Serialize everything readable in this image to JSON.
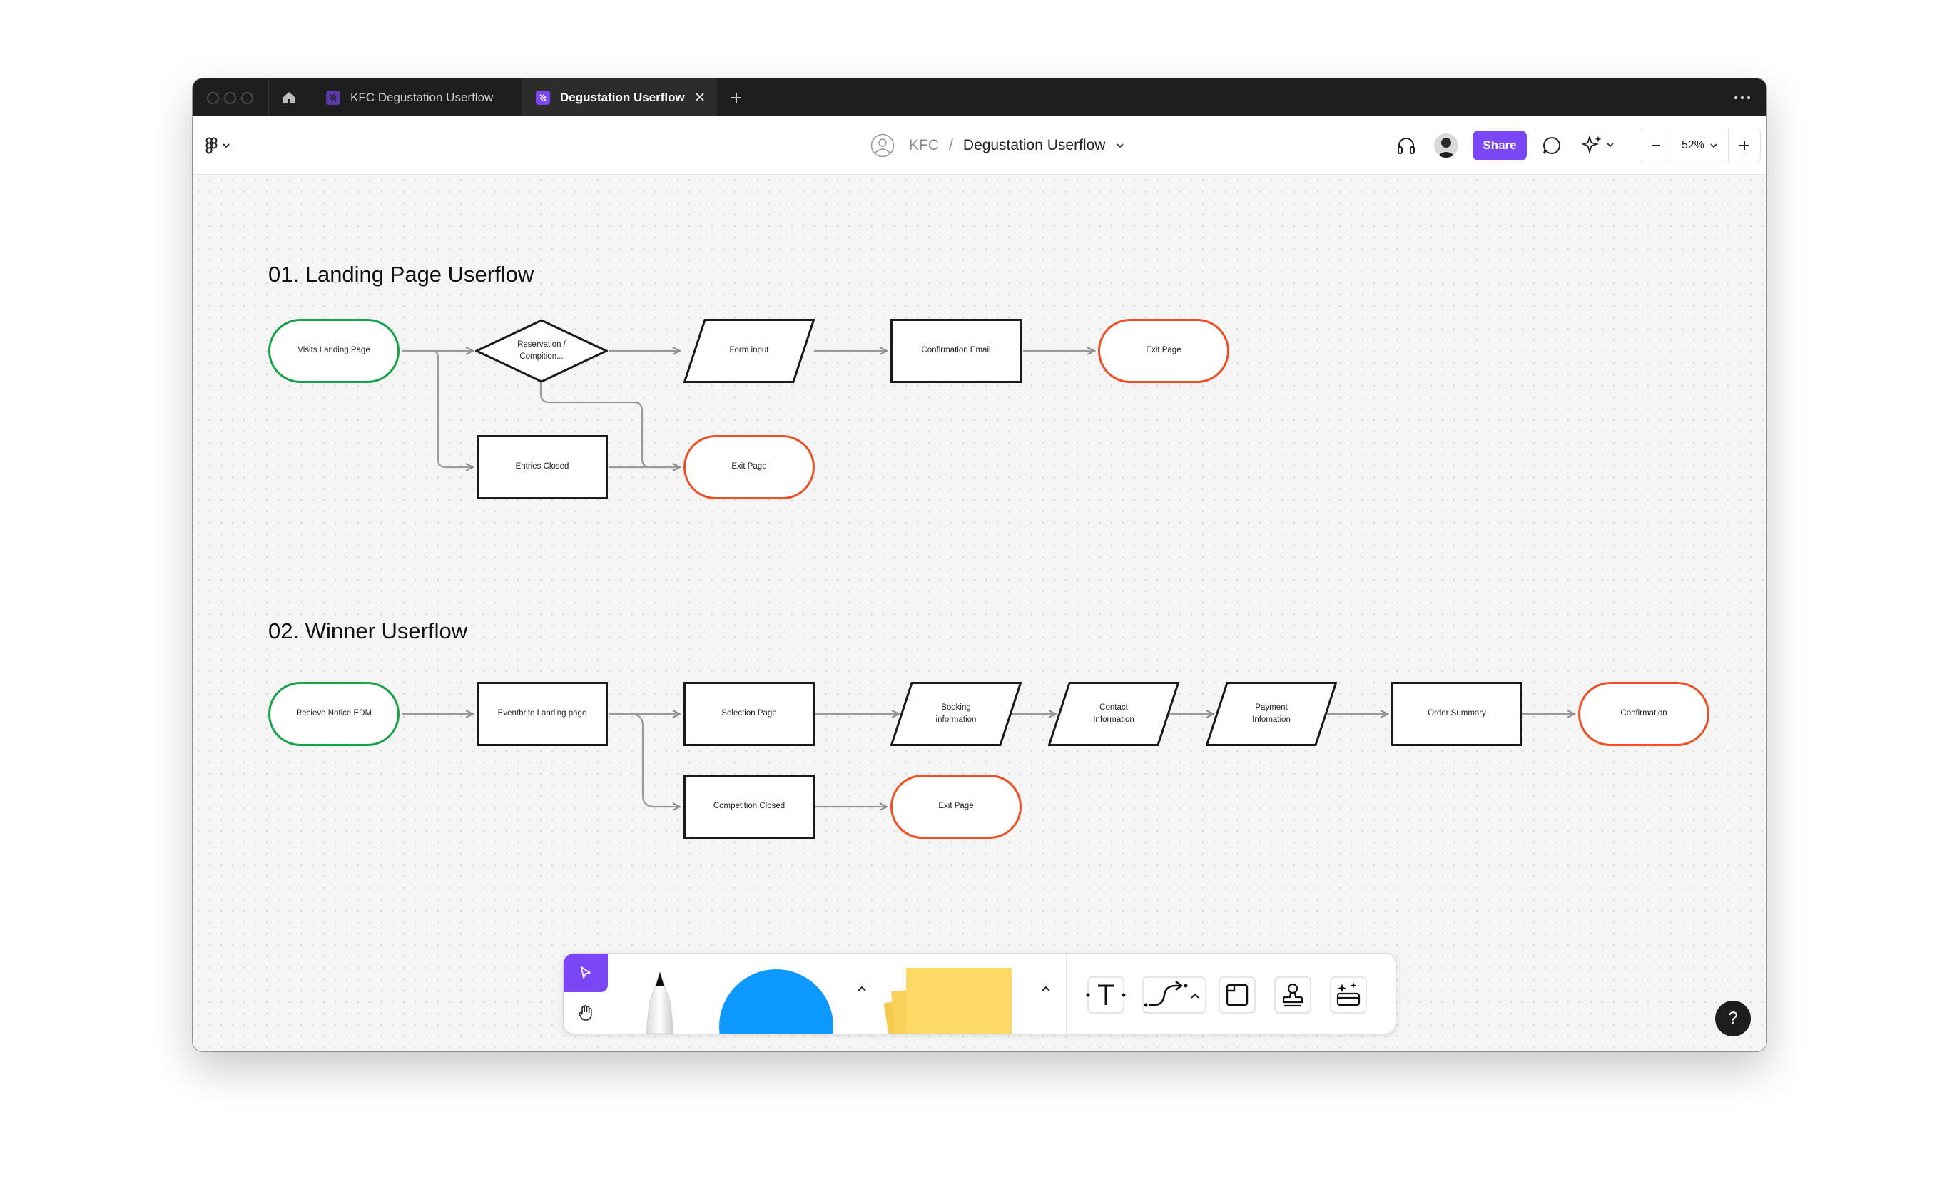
{
  "tabs": [
    {
      "label": "KFC Degustation Userflow",
      "active": false
    },
    {
      "label": "Degustation Userflow",
      "active": true
    }
  ],
  "breadcrumb": {
    "team": "KFC",
    "separator": "/",
    "file": "Degustation Userflow"
  },
  "toolbar": {
    "share_label": "Share",
    "zoom": "52%"
  },
  "sections": {
    "s1_title": "01. Landing Page Userflow",
    "s2_title": "02.  Winner Userflow"
  },
  "flow1": {
    "visits": "Visits Landing Page",
    "reservation": "Reservation / Compition...",
    "form": "Form input",
    "confirm_email": "Confirmation Email",
    "exit1": "Exit Page",
    "entries_closed": "Entries Closed",
    "exit2": "Exit Page"
  },
  "flow2": {
    "notice": "Recieve Notice EDM",
    "eventbrite": "Eventbrite Landing page",
    "selection": "Selection Page",
    "booking": "Booking information",
    "contact": "Contact Information",
    "payment": "Payment Infomation",
    "summary": "Order Summary",
    "confirmation": "Confirmation",
    "comp_closed": "Competition Closed",
    "exit": "Exit Page"
  },
  "help_label": "?",
  "colors": {
    "accent": "#7b46f6",
    "start_green": "#16a34a",
    "end_orange": "#f04e23",
    "shape_blue": "#0d99ff",
    "sticky_yellow": "#ffd966"
  },
  "icons": [
    "home-icon",
    "file-icon",
    "close-icon",
    "plus-icon",
    "more-icon",
    "figma-menu-icon",
    "avatar-icon",
    "headphones-icon",
    "comment-icon",
    "sparkle-icon",
    "minus-icon",
    "chevron-down-icon",
    "cursor-icon",
    "hand-icon",
    "pen-icon",
    "text-icon",
    "connector-icon",
    "section-icon",
    "stamp-icon",
    "widgets-icon",
    "chevron-up-icon"
  ]
}
